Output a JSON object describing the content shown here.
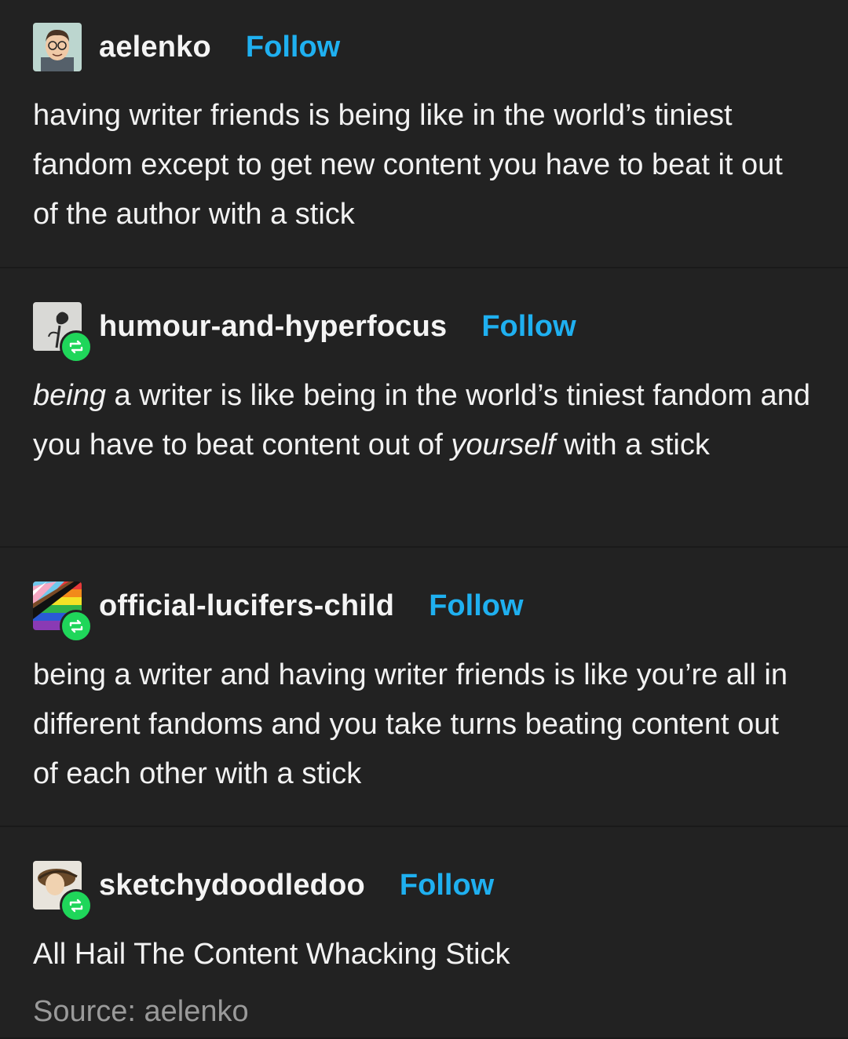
{
  "posts": [
    {
      "username": "aelenko",
      "follow_label": "Follow",
      "avatar_icon": "cartoon-face-avatar",
      "text": "having writer friends is being like in the world’s tiniest fandom except to get new content you have to beat it out of the author with a stick"
    },
    {
      "username": "humour-and-hyperfocus",
      "follow_label": "Follow",
      "avatar_icon": "dark-rose-avatar",
      "reblog_icon": "reblog-icon",
      "text_parts": {
        "em1": "being",
        "mid": " a writer is like being in the world’s tiniest fandom and you have to beat content out of ",
        "em2": "yourself",
        "end": " with a stick"
      }
    },
    {
      "username": "official-lucifers-child",
      "follow_label": "Follow",
      "avatar_icon": "pride-flag-avatar",
      "reblog_icon": "reblog-icon",
      "text": "being a writer and having writer friends is like you’re all in different fandoms and you take turns beating content out of each other with a stick"
    },
    {
      "username": "sketchydoodledoo",
      "follow_label": "Follow",
      "avatar_icon": "drawing-avatar",
      "reblog_icon": "reblog-icon",
      "text": "All Hail The Content Whacking Stick"
    }
  ],
  "source_label": "Source: aelenko",
  "colors": {
    "background": "#222222",
    "follow": "#1fb0f0",
    "reblog_badge": "#1fd65a",
    "source": "#9a9a9a"
  }
}
